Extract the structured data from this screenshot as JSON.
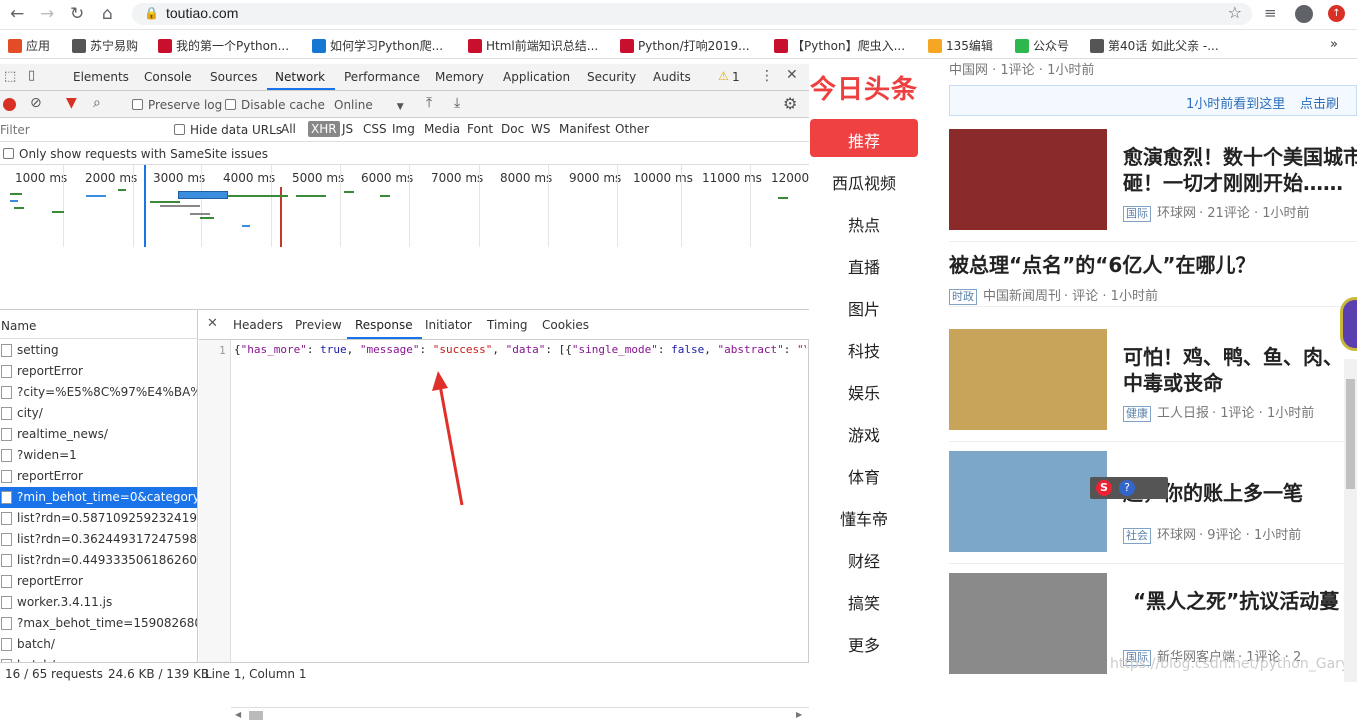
{
  "browser": {
    "url": "toutiao.com",
    "bookmarks": [
      {
        "label": "应用",
        "color": "#e34c26"
      },
      {
        "label": "苏宁易购",
        "color": "#555555"
      },
      {
        "label": "我的第一个Python...",
        "color": "#c8102e"
      },
      {
        "label": "如何学习Python爬...",
        "color": "#1677d2"
      },
      {
        "label": "Html前端知识总结...",
        "color": "#c8102e"
      },
      {
        "label": "Python/打响2019...",
        "color": "#c8102e"
      },
      {
        "label": "【Python】爬虫入...",
        "color": "#c8102e"
      },
      {
        "label": "135编辑",
        "color": "#f5a623"
      },
      {
        "label": "公众号",
        "color": "#2db84d"
      },
      {
        "label": "第40话 如此父亲 -...",
        "color": "#555555"
      }
    ],
    "more": "»"
  },
  "devtools": {
    "tabs": [
      "Elements",
      "Console",
      "Sources",
      "Network",
      "Performance",
      "Memory",
      "Application",
      "Security",
      "Audits"
    ],
    "active_tab": "Network",
    "warn_count": "1",
    "toolbar": {
      "preserve_log": "Preserve log",
      "disable_cache": "Disable cache",
      "throttle": "Online"
    },
    "filter": {
      "placeholder": "Filter",
      "hide_data_urls": "Hide data URLs",
      "types": [
        "All",
        "XHR",
        "JS",
        "CSS",
        "Img",
        "Media",
        "Font",
        "Doc",
        "WS",
        "Manifest",
        "Other"
      ],
      "active_type": "XHR"
    },
    "samesite": "Only show requests with SameSite issues",
    "timeline_ticks": [
      "1000 ms",
      "2000 ms",
      "3000 ms",
      "4000 ms",
      "5000 ms",
      "6000 ms",
      "7000 ms",
      "8000 ms",
      "9000 ms",
      "10000 ms",
      "11000 ms",
      "12000"
    ],
    "name_header": "Name",
    "requests": [
      "setting",
      "reportError",
      "?city=%E5%8C%97%E4%BA%AC",
      "city/",
      "realtime_news/",
      "?widen=1",
      "reportError",
      "?min_behot_time=0&category...",
      "list?rdn=0.5871092592324199",
      "list?rdn=0.3624493172475982",
      "list?rdn=0.44933350618626045",
      "reportError",
      "worker.3.4.11.js",
      "?max_behot_time=1590826807...",
      "batch/",
      "batch/"
    ],
    "selected_request_index": 7,
    "detail_tabs": [
      "Headers",
      "Preview",
      "Response",
      "Initiator",
      "Timing",
      "Cookies"
    ],
    "active_detail_tab": "Response",
    "response": {
      "line_no": "1",
      "parts": [
        {
          "t": "{",
          "c": "#222222"
        },
        {
          "t": "\"has_more\"",
          "c": "#881391"
        },
        {
          "t": ": ",
          "c": "#222222"
        },
        {
          "t": "true",
          "c": "#1a1aa6"
        },
        {
          "t": ", ",
          "c": "#222222"
        },
        {
          "t": "\"message\"",
          "c": "#881391"
        },
        {
          "t": ": ",
          "c": "#222222"
        },
        {
          "t": "\"success\"",
          "c": "#c41a16"
        },
        {
          "t": ", ",
          "c": "#222222"
        },
        {
          "t": "\"data\"",
          "c": "#881391"
        },
        {
          "t": ": [{",
          "c": "#222222"
        },
        {
          "t": "\"single_mode\"",
          "c": "#881391"
        },
        {
          "t": ": ",
          "c": "#222222"
        },
        {
          "t": "false",
          "c": "#1a1aa6"
        },
        {
          "t": ", ",
          "c": "#222222"
        },
        {
          "t": "\"abstract\"",
          "c": "#881391"
        },
        {
          "t": ": ",
          "c": "#222222"
        },
        {
          "t": "\"\\",
          "c": "#c41a16"
        }
      ]
    },
    "status": {
      "requests": "16 / 65 requests",
      "size": "24.6 KB / 139 KB",
      "position": "Line 1, Column 1"
    }
  },
  "page": {
    "logo": "今日头条",
    "top_meta": "中国网 · 1评论 · 1小时前",
    "refresh_bar": {
      "text": "1小时前看到这里",
      "link": "点击刷"
    },
    "channels": [
      "推荐",
      "西瓜视频",
      "热点",
      "直播",
      "图片",
      "科技",
      "娱乐",
      "游戏",
      "体育",
      "懂车帝",
      "财经",
      "搞笑",
      "更多"
    ],
    "active_channel": "推荐",
    "news": [
      {
        "title": "愈演愈烈！数十个美国城市",
        "title2": "砸！一切才刚刚开始……",
        "tag": "国际",
        "source": "环球网",
        "meta": "· 21评论 · 1小时前",
        "thumb": "#8b2a2a"
      },
      {
        "title": "被总理“点名”的“6亿人”在哪儿？",
        "tag": "时政",
        "source": "中国新闻周刊",
        "meta": "· 评论 · 1小时前"
      },
      {
        "title": "可怕！鸡、鸭、鱼、肉、",
        "title2": "中毒或丧命",
        "tag": "健康",
        "source": "工人日报",
        "meta": "· 1评论 · 1小时前",
        "thumb": "#c8a45a"
      },
      {
        "title": "起，你的账上多一笔",
        "tag": "社会",
        "source": "环球网",
        "meta": "· 9评论 · 1小时前",
        "thumb": "#7da7c9"
      },
      {
        "title": "“黑人之死”抗议活动蔓",
        "tag": "国际",
        "source": "新华网客户端",
        "meta": "· 1评论 · 2",
        "thumb": "#8a8a8a"
      }
    ],
    "watermark": "https://blog.csdn.net/python_Gary"
  }
}
